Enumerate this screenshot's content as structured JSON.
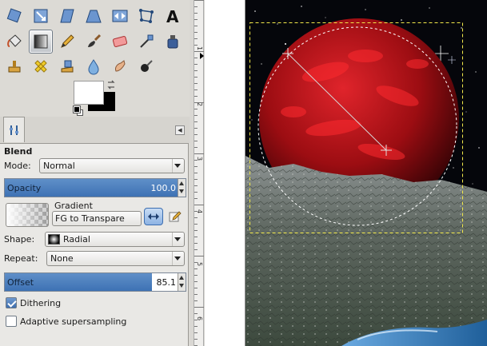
{
  "toolbox": {
    "tools": [
      {
        "name": "rotate-tool-icon"
      },
      {
        "name": "scale-tool-icon"
      },
      {
        "name": "shear-tool-icon"
      },
      {
        "name": "perspective-tool-icon"
      },
      {
        "name": "flip-tool-icon"
      },
      {
        "name": "cage-transform-tool-icon"
      },
      {
        "name": "text-tool-icon"
      },
      {
        "name": "bucket-fill-tool-icon"
      },
      {
        "name": "blend-tool-icon"
      },
      {
        "name": "pencil-tool-icon"
      },
      {
        "name": "paintbrush-tool-icon"
      },
      {
        "name": "eraser-tool-icon"
      },
      {
        "name": "airbrush-tool-icon"
      },
      {
        "name": "ink-tool-icon"
      },
      {
        "name": "clone-tool-icon"
      },
      {
        "name": "heal-tool-icon"
      },
      {
        "name": "perspective-clone-tool-icon"
      },
      {
        "name": "blur-tool-icon"
      },
      {
        "name": "smudge-tool-icon"
      },
      {
        "name": "dodge-burn-tool-icon"
      }
    ],
    "active_tool": "blend-tool-icon",
    "fg_color": "#ffffff",
    "bg_color": "#000000"
  },
  "tool_options": {
    "title": "Blend",
    "mode_label": "Mode:",
    "mode_value": "Normal",
    "opacity_label": "Opacity",
    "opacity_value": "100.0",
    "opacity_fraction": 1.0,
    "gradient_label": "Gradient",
    "gradient_value": "FG to Transpare",
    "shape_label": "Shape:",
    "shape_value": "Radial",
    "repeat_label": "Repeat:",
    "repeat_value": "None",
    "offset_label": "Offset",
    "offset_value": "85.1",
    "offset_fraction": 0.851,
    "dithering_label": "Dithering",
    "dithering_checked": true,
    "adaptive_label": "Adaptive supersampling",
    "adaptive_checked": false
  },
  "ruler": {
    "labels": [
      "1",
      "2",
      "3",
      "4",
      "5",
      "6"
    ]
  },
  "colors": {
    "accent": "#3e72b4",
    "planet_red": "#c0131a",
    "sky": "#05060b"
  }
}
